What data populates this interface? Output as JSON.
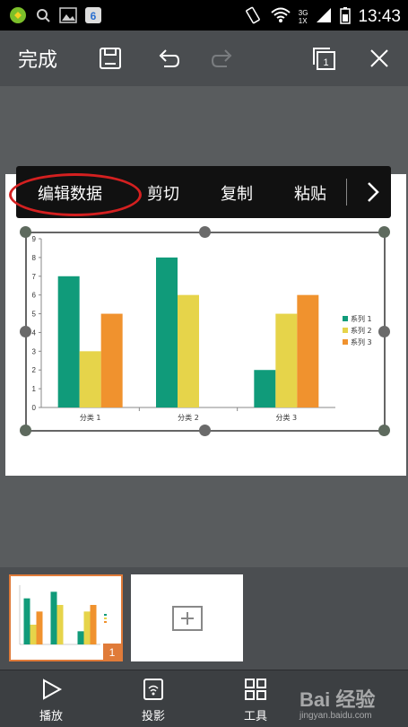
{
  "status_bar": {
    "time": "13:43",
    "network_top": "3G",
    "network_bottom": "1X"
  },
  "toolbar": {
    "done_label": "完成"
  },
  "context_menu": {
    "items": [
      "编辑数据",
      "剪切",
      "复制",
      "粘贴"
    ]
  },
  "thumbnails": {
    "current_index": "1"
  },
  "bottom_bar": {
    "play_label": "播放",
    "project_label": "投影",
    "tools_label": "工具"
  },
  "watermark": {
    "main": "Bai 经验",
    "sub": "jingyan.baidu.com"
  },
  "colors": {
    "series1": "#109b7a",
    "series2": "#e6d44a",
    "series3": "#f0922e",
    "accent": "#e07b39",
    "highlight": "#d42020"
  },
  "chart_data": {
    "type": "bar",
    "categories": [
      "分类 1",
      "分类 2",
      "分类 3"
    ],
    "series": [
      {
        "name": "系列 1",
        "values": [
          7,
          8,
          2
        ]
      },
      {
        "name": "系列 2",
        "values": [
          3,
          6,
          5
        ]
      },
      {
        "name": "系列 3",
        "values": [
          5,
          0,
          6
        ]
      }
    ],
    "yticks": [
      "0",
      "1",
      "2",
      "3",
      "4",
      "5",
      "6",
      "7",
      "8",
      "9"
    ],
    "ylim": [
      0,
      9
    ],
    "legend": "right"
  }
}
